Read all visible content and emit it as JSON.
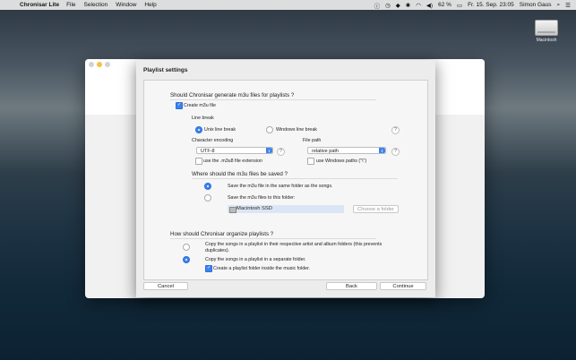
{
  "menubar": {
    "apple": "",
    "app_name": "Chronisar Lite",
    "items": [
      "File",
      "Selection",
      "Window",
      "Help"
    ],
    "battery": "62 %",
    "datetime": "Fr. 15. Sep.  23:05",
    "user": "Simon Gaus"
  },
  "desktop": {
    "disk_label": "Macintosh"
  },
  "sheet": {
    "title": "Playlist settings",
    "q1": "Should Chronisar generate m3u files for playlists ?",
    "create_m3u": "Create m3u file",
    "line_break_label": "Line break",
    "unix_line_break": "Unix line break",
    "windows_line_break": "Windows line break",
    "char_encoding_label": "Character encoding",
    "encoding_value": "UTF-8",
    "file_path_label": "File path",
    "file_path_value": "relative path",
    "m3u8_ext": "use the .m3u8 file extension",
    "windows_paths": "use Windows paths (\"\\\")",
    "help_glyph": "?",
    "q2": "Where should the m3u files be saved ?",
    "save_same_folder": "Save the m3u file in the same folder as the songs.",
    "save_this_folder": "Save the m3u files to this folder:",
    "folder_value": "Macintosh SSD",
    "choose_folder": "Choose a folder",
    "q3": "How should Chronisar organize playlists ?",
    "copy_artist_album": "Copy the songs in a playlist in their respective artist and album folders (this prevents",
    "copy_artist_album_2": "duplicates).",
    "copy_separate": "Copy the songs in a playlist in a separate folder.",
    "create_playlist_folder": "Create a playlist folder inside the music folder.",
    "cancel": "Cancel",
    "back": "Back",
    "continue": "Continue"
  },
  "colors": {
    "accent": "#3b82f0"
  }
}
